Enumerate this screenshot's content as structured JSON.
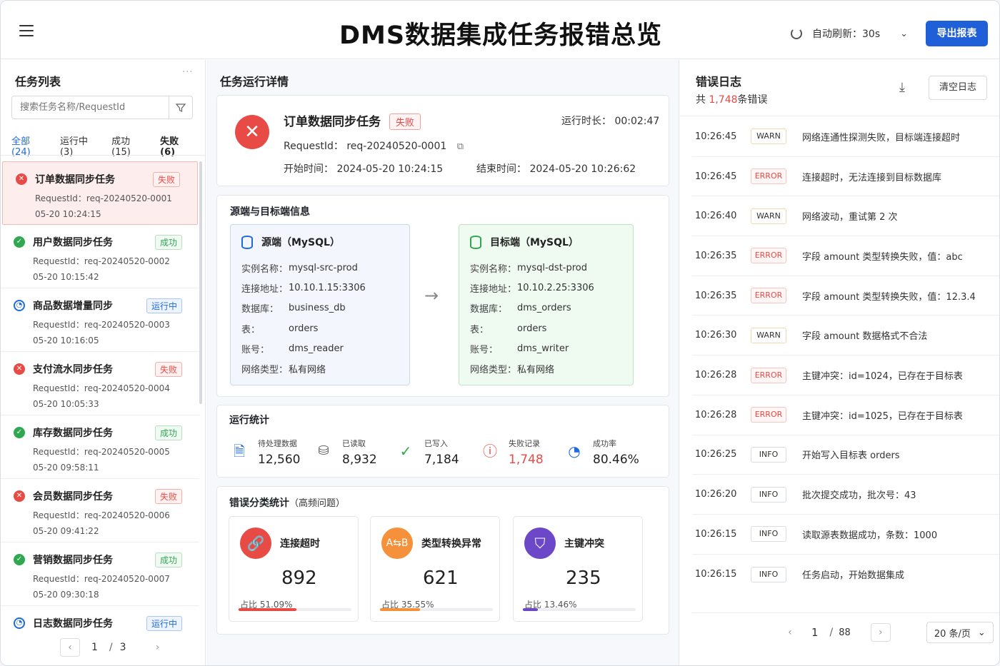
{
  "header": {
    "title": "DMS数据集成任务报错总览",
    "refresh_label": "自动刷新：30s",
    "export_label": "导出报表"
  },
  "tasklist": {
    "title": "任务列表",
    "more": "···",
    "search_placeholder": "搜索任务名称/RequestId",
    "tabs": [
      {
        "label": "全部(24)"
      },
      {
        "label": "运行中(3)"
      },
      {
        "label": "成功(15)"
      },
      {
        "label": "失败(6)"
      }
    ],
    "items": [
      {
        "name": "订单数据同步任务",
        "status": "失败",
        "kind": "fail",
        "rid": "RequestId：req-20240520-0001",
        "time": "05-20 10:24:15"
      },
      {
        "name": "用户数据同步任务",
        "status": "成功",
        "kind": "ok",
        "rid": "RequestId：req-20240520-0002",
        "time": "05-20 10:15:42"
      },
      {
        "name": "商品数据增量同步",
        "status": "运行中",
        "kind": "run",
        "rid": "RequestId：req-20240520-0003",
        "time": "05-20 10:16:05"
      },
      {
        "name": "支付流水同步任务",
        "status": "失败",
        "kind": "fail",
        "rid": "RequestId：req-20240520-0004",
        "time": "05-20 10:05:33"
      },
      {
        "name": "库存数据同步任务",
        "status": "成功",
        "kind": "ok",
        "rid": "RequestId：req-20240520-0005",
        "time": "05-20 09:58:11"
      },
      {
        "name": "会员数据同步任务",
        "status": "失败",
        "kind": "fail",
        "rid": "RequestId：req-20240520-0006",
        "time": "05-20 09:41:22"
      },
      {
        "name": "营销数据同步任务",
        "status": "成功",
        "kind": "ok",
        "rid": "RequestId：req-20240520-0007",
        "time": "05-20 09:30:18"
      },
      {
        "name": "日志数据同步任务",
        "status": "运行中",
        "kind": "run",
        "rid": "",
        "time": ""
      }
    ],
    "pager": {
      "current": "1",
      "sep": "/",
      "total": "3"
    }
  },
  "detail": {
    "title": "任务运行详情",
    "task_name": "订单数据同步任务",
    "status": "失败",
    "duration": "运行时长：  00:02:47",
    "request_id": "RequestId：  req-20240520-0001",
    "start_time": "开始时间：  2024-05-20 10:24:15",
    "end_time": "结束时间：  2024-05-20 10:26:62"
  },
  "endpoints": {
    "title": "源端与目标端信息",
    "source": {
      "title": "源端（MySQL）",
      "rows": [
        {
          "k": "实例名称：",
          "v": "mysql-src-prod"
        },
        {
          "k": "连接地址：",
          "v": "10.10.1.15:3306"
        },
        {
          "k": "数据库：",
          "v": "business_db"
        },
        {
          "k": "表：",
          "v": "orders"
        },
        {
          "k": "账号：",
          "v": "dms_reader"
        },
        {
          "k": "网络类型：",
          "v": "私有网络"
        }
      ]
    },
    "target": {
      "title": "目标端（MySQL）",
      "rows": [
        {
          "k": "实例名称：",
          "v": "mysql-dst-prod"
        },
        {
          "k": "连接地址：",
          "v": "10.10.2.25:3306"
        },
        {
          "k": "数据库：",
          "v": "dms_orders"
        },
        {
          "k": "表：",
          "v": "orders"
        },
        {
          "k": "账号：",
          "v": "dms_writer"
        },
        {
          "k": "网络类型：",
          "v": "私有网络"
        }
      ]
    }
  },
  "stats": {
    "title": "运行统计",
    "items": [
      {
        "label": "待处理数据",
        "value": "12,560"
      },
      {
        "label": "已读取",
        "value": "8,932"
      },
      {
        "label": "已写入",
        "value": "7,184"
      },
      {
        "label": "失败记录",
        "value": "1,748"
      },
      {
        "label": "成功率",
        "value": "80.46%"
      }
    ]
  },
  "errcat": {
    "title": "错误分类统计",
    "subtitle": "（高频问题）",
    "items": [
      {
        "name": "连接超时",
        "count": "892",
        "pct": "占比  51.09%",
        "fraction": 0.5109,
        "color": "#e84a45"
      },
      {
        "name": "类型转换异常",
        "count": "621",
        "pct": "占比  35.55%",
        "fraction": 0.3555,
        "color": "#f5913b"
      },
      {
        "name": "主键冲突",
        "count": "235",
        "pct": "占比  13.46%",
        "fraction": 0.1346,
        "color": "#6c48c8"
      }
    ]
  },
  "log": {
    "title": "错误日志",
    "count_prefix": "共",
    "count": "1,748",
    "count_suffix": "条错误",
    "clear_label": "清空日志",
    "rows": [
      {
        "t": "10:26:45",
        "lvl": "WARN",
        "msg": "网络连通性探测失败，目标端连接超时"
      },
      {
        "t": "10:26:45",
        "lvl": "ERROR",
        "msg": "连接超时，无法连接到目标数据库"
      },
      {
        "t": "10:26:40",
        "lvl": "WARN",
        "msg": "网络波动，重试第 2 次"
      },
      {
        "t": "10:26:35",
        "lvl": "ERROR",
        "msg": "字段 amount 类型转换失败，值：abc"
      },
      {
        "t": "10:26:35",
        "lvl": "ERROR",
        "msg": "字段 amount 类型转换失败，值：12.3.4"
      },
      {
        "t": "10:26:30",
        "lvl": "WARN",
        "msg": "字段 amount 数据格式不合法"
      },
      {
        "t": "10:26:28",
        "lvl": "ERROR",
        "msg": "主键冲突：id=1024，已存在于目标表"
      },
      {
        "t": "10:26:28",
        "lvl": "ERROR",
        "msg": "主键冲突：id=1025，已存在于目标表"
      },
      {
        "t": "10:26:25",
        "lvl": "INFO",
        "msg": "开始写入目标表 orders"
      },
      {
        "t": "10:26:20",
        "lvl": "INFO",
        "msg": "批次提交成功，批次号：43"
      },
      {
        "t": "10:26:15",
        "lvl": "INFO",
        "msg": "读取源表数据成功，条数：1000"
      },
      {
        "t": "10:26:15",
        "lvl": "INFO",
        "msg": "任务启动，开始数据集成"
      }
    ],
    "pager": {
      "current": "1",
      "sep": "/",
      "total": "88",
      "size": "20 条/页"
    }
  }
}
